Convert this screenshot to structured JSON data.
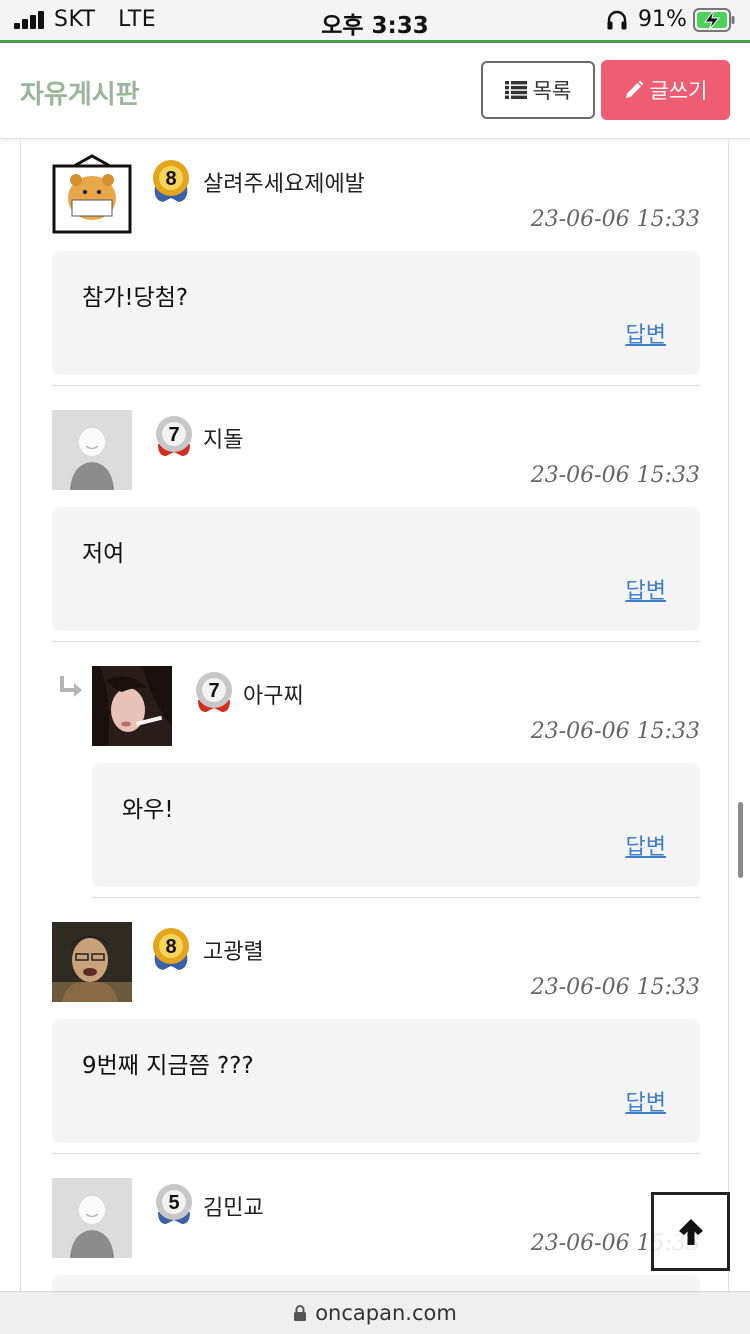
{
  "status_bar": {
    "carrier": "SKT",
    "network": "LTE",
    "time": "오후 3:33",
    "battery_percent": "91%"
  },
  "header": {
    "title": "자유게시판",
    "list_button": "목록",
    "write_button": "글쓰기"
  },
  "comments": [
    {
      "nickname": "살려주세요제에발",
      "level": "8",
      "date": "23-06-06 15:33",
      "text": "참가!당첨?",
      "reply_label": "답변",
      "avatar": "kakao-character-photo",
      "is_reply": false
    },
    {
      "nickname": "지돌",
      "level": "7",
      "date": "23-06-06 15:33",
      "text": "저여",
      "reply_label": "답변",
      "avatar": "default-user",
      "is_reply": false
    },
    {
      "nickname": "아구찌",
      "level": "7",
      "date": "23-06-06 15:33",
      "text": "와우!",
      "reply_label": "답변",
      "avatar": "woman-photo",
      "is_reply": true
    },
    {
      "nickname": "고광렬",
      "level": "8",
      "date": "23-06-06 15:33",
      "text": "9번째 지금쯤 ???",
      "reply_label": "답변",
      "avatar": "man-photo",
      "is_reply": false
    },
    {
      "nickname": "김민교",
      "level": "5",
      "date": "23-06-06 15:33",
      "text": "",
      "reply_label": "",
      "avatar": "default-user",
      "is_reply": false
    }
  ],
  "url_bar": {
    "url": "oncapan.com"
  },
  "colors": {
    "accent_green": "#4a9e4a",
    "write_button": "#ee5d72",
    "title": "#9ab59a",
    "link": "#3d7fc8"
  }
}
